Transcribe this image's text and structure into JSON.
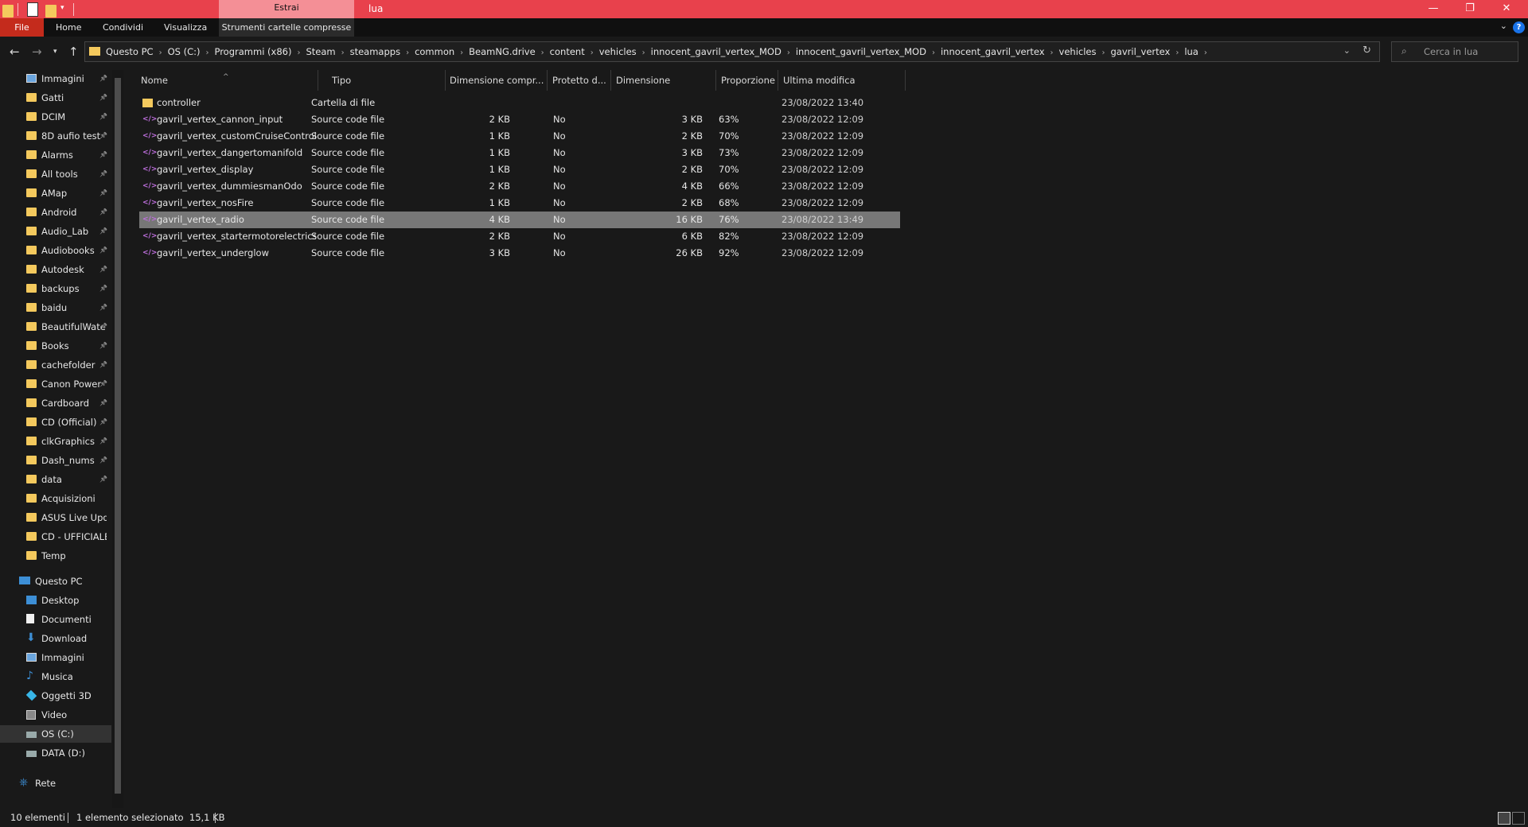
{
  "window": {
    "title": "lua",
    "contextual_tab_group": "Estrai",
    "min": "—",
    "restore": "❐",
    "close": "✕"
  },
  "ribbon": {
    "tabs": [
      "File",
      "Home",
      "Condividi",
      "Visualizza",
      "Strumenti cartelle compresse"
    ]
  },
  "address": {
    "crumbs": [
      "Questo PC",
      "OS (C:)",
      "Programmi (x86)",
      "Steam",
      "steamapps",
      "common",
      "BeamNG.drive",
      "content",
      "vehicles",
      "innocent_gavril_vertex_MOD",
      "innocent_gavril_vertex_MOD",
      "innocent_gavril_vertex",
      "vehicles",
      "gavril_vertex",
      "lua"
    ],
    "search_placeholder": "Cerca in lua"
  },
  "sidebar": {
    "quick_access": [
      {
        "label": "Immagini",
        "icon": "pictures-icon"
      },
      {
        "label": "Gatti",
        "icon": "folder-icon"
      },
      {
        "label": "DCIM",
        "icon": "folder-icon"
      },
      {
        "label": "8D aufio test",
        "icon": "folder-icon"
      },
      {
        "label": "Alarms",
        "icon": "folder-icon"
      },
      {
        "label": "All tools",
        "icon": "folder-icon"
      },
      {
        "label": "AMap",
        "icon": "folder-icon"
      },
      {
        "label": "Android",
        "icon": "folder-icon"
      },
      {
        "label": "Audio_Lab",
        "icon": "folder-icon"
      },
      {
        "label": "Audiobooks",
        "icon": "folder-icon"
      },
      {
        "label": "Autodesk",
        "icon": "folder-icon"
      },
      {
        "label": "backups",
        "icon": "folder-icon"
      },
      {
        "label": "baidu",
        "icon": "folder-icon"
      },
      {
        "label": "BeautifulWate",
        "icon": "folder-icon"
      },
      {
        "label": "Books",
        "icon": "folder-icon"
      },
      {
        "label": "cachefolder",
        "icon": "folder-icon"
      },
      {
        "label": "Canon Power",
        "icon": "folder-icon"
      },
      {
        "label": "Cardboard",
        "icon": "folder-icon"
      },
      {
        "label": "CD (Official)",
        "icon": "folder-icon"
      },
      {
        "label": "clkGraphics",
        "icon": "folder-icon"
      },
      {
        "label": "Dash_nums",
        "icon": "folder-icon"
      },
      {
        "label": "data",
        "icon": "folder-icon"
      },
      {
        "label": "Acquisizioni",
        "icon": "folder-icon"
      },
      {
        "label": "ASUS Live Updat",
        "icon": "folder-icon"
      },
      {
        "label": "CD - UFFICIALE",
        "icon": "folder-icon"
      },
      {
        "label": "Temp",
        "icon": "folder-icon"
      }
    ],
    "this_pc": "Questo PC",
    "pc_items": [
      {
        "label": "Desktop"
      },
      {
        "label": "Documenti"
      },
      {
        "label": "Download"
      },
      {
        "label": "Immagini"
      },
      {
        "label": "Musica"
      },
      {
        "label": "Oggetti 3D"
      },
      {
        "label": "Video"
      },
      {
        "label": "OS (C:)"
      },
      {
        "label": "DATA (D:)"
      }
    ],
    "network": "Rete"
  },
  "columns": {
    "name": "Nome",
    "type": "Tipo",
    "compressed": "Dimensione compr...",
    "protected": "Protetto d...",
    "size": "Dimensione",
    "ratio": "Proporzione",
    "modified": "Ultima modifica"
  },
  "files": [
    {
      "name": "controller",
      "type": "Cartella di file",
      "compressed": "",
      "protected": "",
      "size": "",
      "ratio": "",
      "modified": "23/08/2022 13:40"
    },
    {
      "name": "gavril_vertex_cannon_input",
      "type": "Source code file",
      "compressed": "2 KB",
      "protected": "No",
      "size": "3 KB",
      "ratio": "63%",
      "modified": "23/08/2022 12:09"
    },
    {
      "name": "gavril_vertex_customCruiseControl",
      "type": "Source code file",
      "compressed": "1 KB",
      "protected": "No",
      "size": "2 KB",
      "ratio": "70%",
      "modified": "23/08/2022 12:09"
    },
    {
      "name": "gavril_vertex_dangertomanifold",
      "type": "Source code file",
      "compressed": "1 KB",
      "protected": "No",
      "size": "3 KB",
      "ratio": "73%",
      "modified": "23/08/2022 12:09"
    },
    {
      "name": "gavril_vertex_display",
      "type": "Source code file",
      "compressed": "1 KB",
      "protected": "No",
      "size": "2 KB",
      "ratio": "70%",
      "modified": "23/08/2022 12:09"
    },
    {
      "name": "gavril_vertex_dummiesmanOdo",
      "type": "Source code file",
      "compressed": "2 KB",
      "protected": "No",
      "size": "4 KB",
      "ratio": "66%",
      "modified": "23/08/2022 12:09"
    },
    {
      "name": "gavril_vertex_nosFire",
      "type": "Source code file",
      "compressed": "1 KB",
      "protected": "No",
      "size": "2 KB",
      "ratio": "68%",
      "modified": "23/08/2022 12:09"
    },
    {
      "name": "gavril_vertex_radio",
      "type": "Source code file",
      "compressed": "4 KB",
      "protected": "No",
      "size": "16 KB",
      "ratio": "76%",
      "modified": "23/08/2022 13:49"
    },
    {
      "name": "gavril_vertex_startermotorelectrics",
      "type": "Source code file",
      "compressed": "2 KB",
      "protected": "No",
      "size": "6 KB",
      "ratio": "82%",
      "modified": "23/08/2022 12:09"
    },
    {
      "name": "gavril_vertex_underglow",
      "type": "Source code file",
      "compressed": "3 KB",
      "protected": "No",
      "size": "26 KB",
      "ratio": "92%",
      "modified": "23/08/2022 12:09"
    }
  ],
  "status": {
    "count": "10 elementi",
    "selection": "1 elemento selezionato  15,1 KB"
  }
}
